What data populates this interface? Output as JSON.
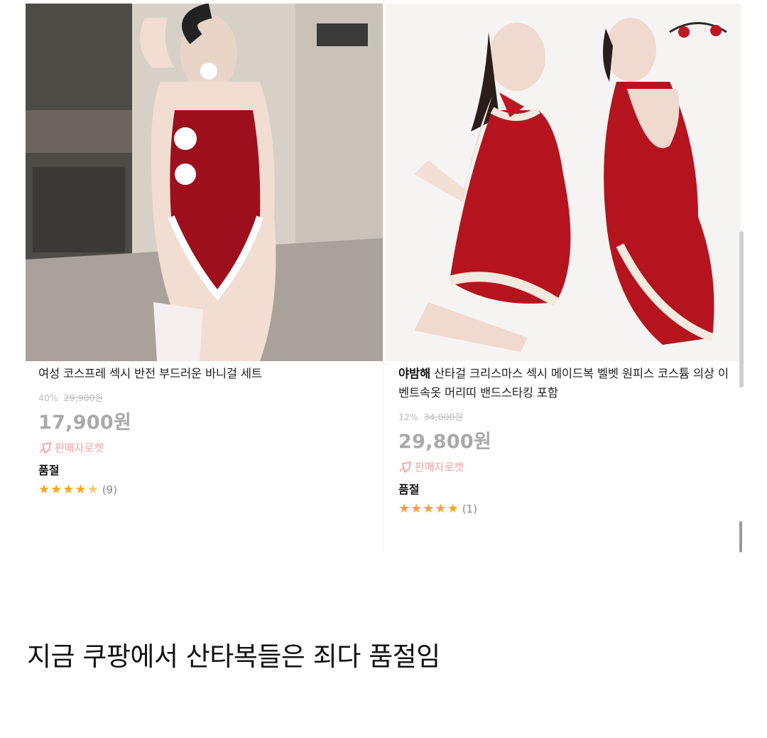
{
  "products": [
    {
      "title": "여성 코스프레 섹시 반전 부드러운 바니걸 세트",
      "brand": "",
      "discount_pct": "40%",
      "original_price": "29,900원",
      "price": "17,900원",
      "badge": "판매자로켓",
      "status": "품절",
      "rating_stars": 4.5,
      "review_count": "(9)"
    },
    {
      "brand": "야밤해",
      "title": "산타걸 크리스마스 섹시 메이드복 벨벳 원피스 코스튬 의상 이벤트속옷 머리띠 밴드스타킹 포함",
      "discount_pct": "12%",
      "original_price": "34,000원",
      "price": "29,800원",
      "badge": "판매자로켓",
      "status": "품절",
      "rating_stars": 5,
      "review_count": "(1)"
    }
  ],
  "caption": "지금 쿠팡에서 산타복들은 죄다 품절임",
  "colors": {
    "price": "#a9a9a9",
    "badge": "#f4a3a0",
    "star": "#f4a623",
    "dress_red": "#b5141e"
  }
}
